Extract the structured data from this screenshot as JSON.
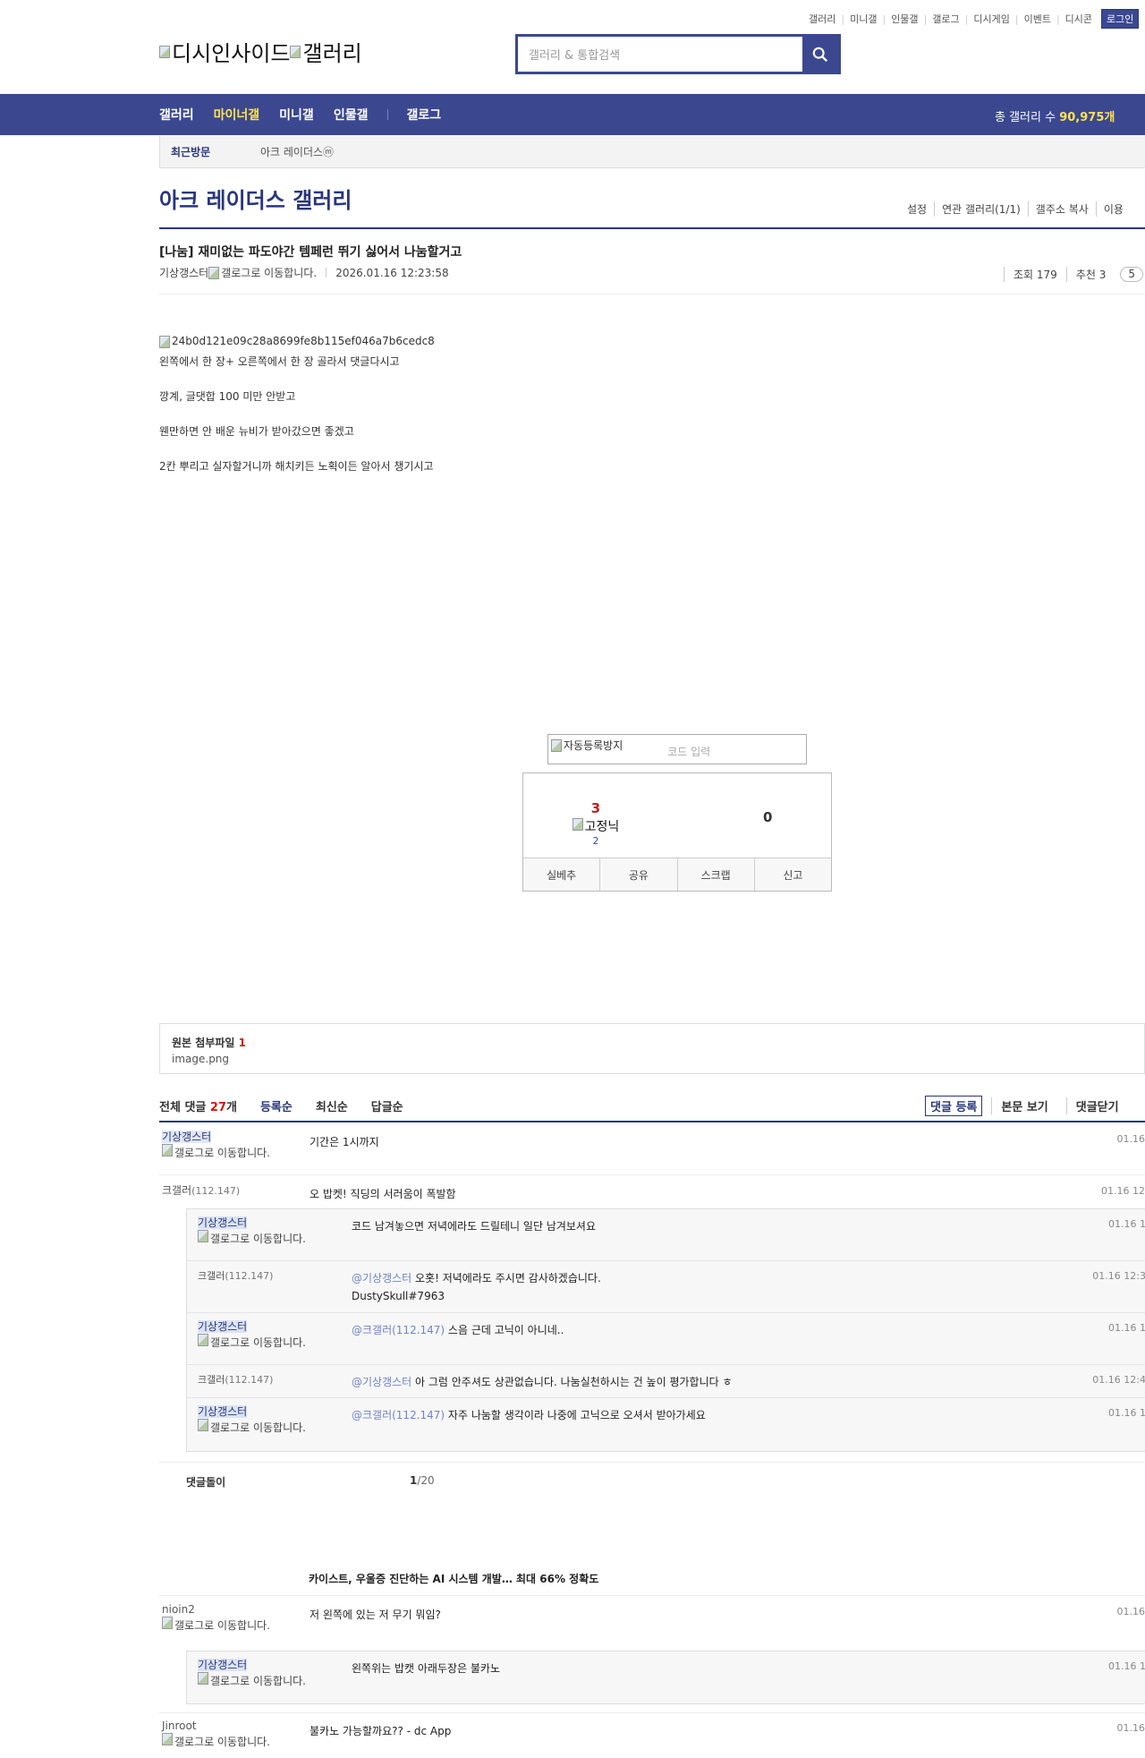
{
  "top_links": [
    "갤러리",
    "미니갤",
    "인물갤",
    "갤로그",
    "디시게임",
    "이벤트",
    "디시콘"
  ],
  "login_label": "로그인",
  "logo_alt": [
    "디시인사이드",
    "갤러리"
  ],
  "search": {
    "placeholder": "갤러리 & 통합검색",
    "icon": "search-icon"
  },
  "nav": {
    "items": [
      "갤러리",
      "마이너갤",
      "미니갤",
      "인물갤",
      "갤로그"
    ],
    "active": "마이너갤",
    "total_prefix": "총 갤러리 수 ",
    "total_value": "90,975개"
  },
  "recent": {
    "label": "최근방문",
    "item": "아크 레이더스ⓜ"
  },
  "gallery": {
    "title": "아크 레이더스 갤러리",
    "tools": [
      "설정",
      "연관 갤러리(1/1)",
      "갤주소 복사",
      "이용"
    ]
  },
  "post": {
    "title": "[나눔] 재미없는 파도야간 템페런 뛰기 싫어서 나눔할거고",
    "author": "기상갱스터",
    "gallog_alt": "갤로그로 이동합니다.",
    "date": "2026.01.16 12:23:58",
    "views": "조회 179",
    "recommends": "추천 3",
    "comments_badge": "5",
    "image_alt": "24b0d121e09c28a8699fe8b115ef046a7b6cedc8",
    "lines": [
      "왼쪽에서 한 장+ 오른쪽에서 한 장 골라서 댓글다시고",
      "깡계, 글댓합 100 미만 안받고",
      "웬만하면 안 배운 뉴비가 받아갔으면 좋겠고",
      "2칸 뿌리고 실자할거니까 해치키든 노획이든 알아서 챙기시고"
    ]
  },
  "captcha": {
    "img_alt": "자동등록방지",
    "placeholder": "코드 입력"
  },
  "recommend": {
    "up_count": "3",
    "up_alt": "고정닉",
    "up_sub": "2",
    "down_count": "0",
    "buttons": [
      "실베추",
      "공유",
      "스크랩",
      "신고"
    ]
  },
  "attachment": {
    "label": "원본 첨부파일 ",
    "count": "1",
    "file": "image.png"
  },
  "comments": {
    "total_label": "전체 댓글 ",
    "total_count": "27",
    "total_unit": "개",
    "sorts": [
      "등록순",
      "최신순",
      "답글순"
    ],
    "actions": [
      "댓글 등록",
      "본문 보기",
      "댓글닫기"
    ],
    "items": [
      {
        "nick": "기상갱스터",
        "gallog": "갤로그로 이동합니다.",
        "text": "기간은 1시까지",
        "time": "01.16"
      },
      {
        "nick": "크갤러",
        "ip": "(112.147)",
        "text": "오 밥켓! 직딩의 서러움이 폭발함",
        "time": "01.16 12"
      }
    ],
    "replies": [
      {
        "nick": "기상갱스터",
        "gallog": "갤로그로 이동합니다.",
        "at": "",
        "text": "코드 남겨놓으면 저녁에라도 드릴테니 일단 남겨보셔요",
        "time": "01.16 1"
      },
      {
        "nick": "크갤러",
        "ip": "(112.147)",
        "at": "@기상갱스터",
        "text": " 오홋! 저녁에라도 주시면 감사하겠습니다.",
        "text2": "DustySkull#7963",
        "time": "01.16 12:3"
      },
      {
        "nick": "기상갱스터",
        "gallog": "갤로그로 이동합니다.",
        "at": "@크갤러(112.147)",
        "text": " 스음 근데 고닉이 아니네..",
        "time": "01.16 1"
      },
      {
        "nick": "크갤러",
        "ip": "(112.147)",
        "at": "@기상갱스터",
        "text": " 아 그럼 안주셔도 상관없습니다. 나눔실천하시는 건 높이 평가합니다 ㅎ",
        "time": "01.16 12:4"
      },
      {
        "nick": "기상갱스터",
        "gallog": "갤로그로 이동합니다.",
        "at": "@크갤러(112.147)",
        "text": " 자주 나눔할 생각이라 나중에 고닉으로 오셔서 받아가세요",
        "time": "01.16 1"
      }
    ],
    "bot_label": "댓글돌이",
    "bot_page": "1",
    "bot_total": "/20",
    "ad_title": "카이스트, 우울증 진단하는 AI 시스템 개발… 최대 66% 정확도",
    "items2": [
      {
        "nick": "nioin2",
        "gallog": "갤로그로 이동합니다.",
        "text": "저 왼쪽에 있는 저 무기 뭐임?",
        "time": "01.16"
      },
      {
        "nick": "Jinroot",
        "gallog": "갤로그로 이동합니다.",
        "text": "불카노 가능할까요?? - dc App",
        "time": "01.16"
      }
    ],
    "reply2": {
      "nick": "기상갱스터",
      "gallog": "갤로그로 이동합니다.",
      "text": "왼쪽위는 밥캣 아래두장은 불카노",
      "time": "01.16 1"
    }
  }
}
